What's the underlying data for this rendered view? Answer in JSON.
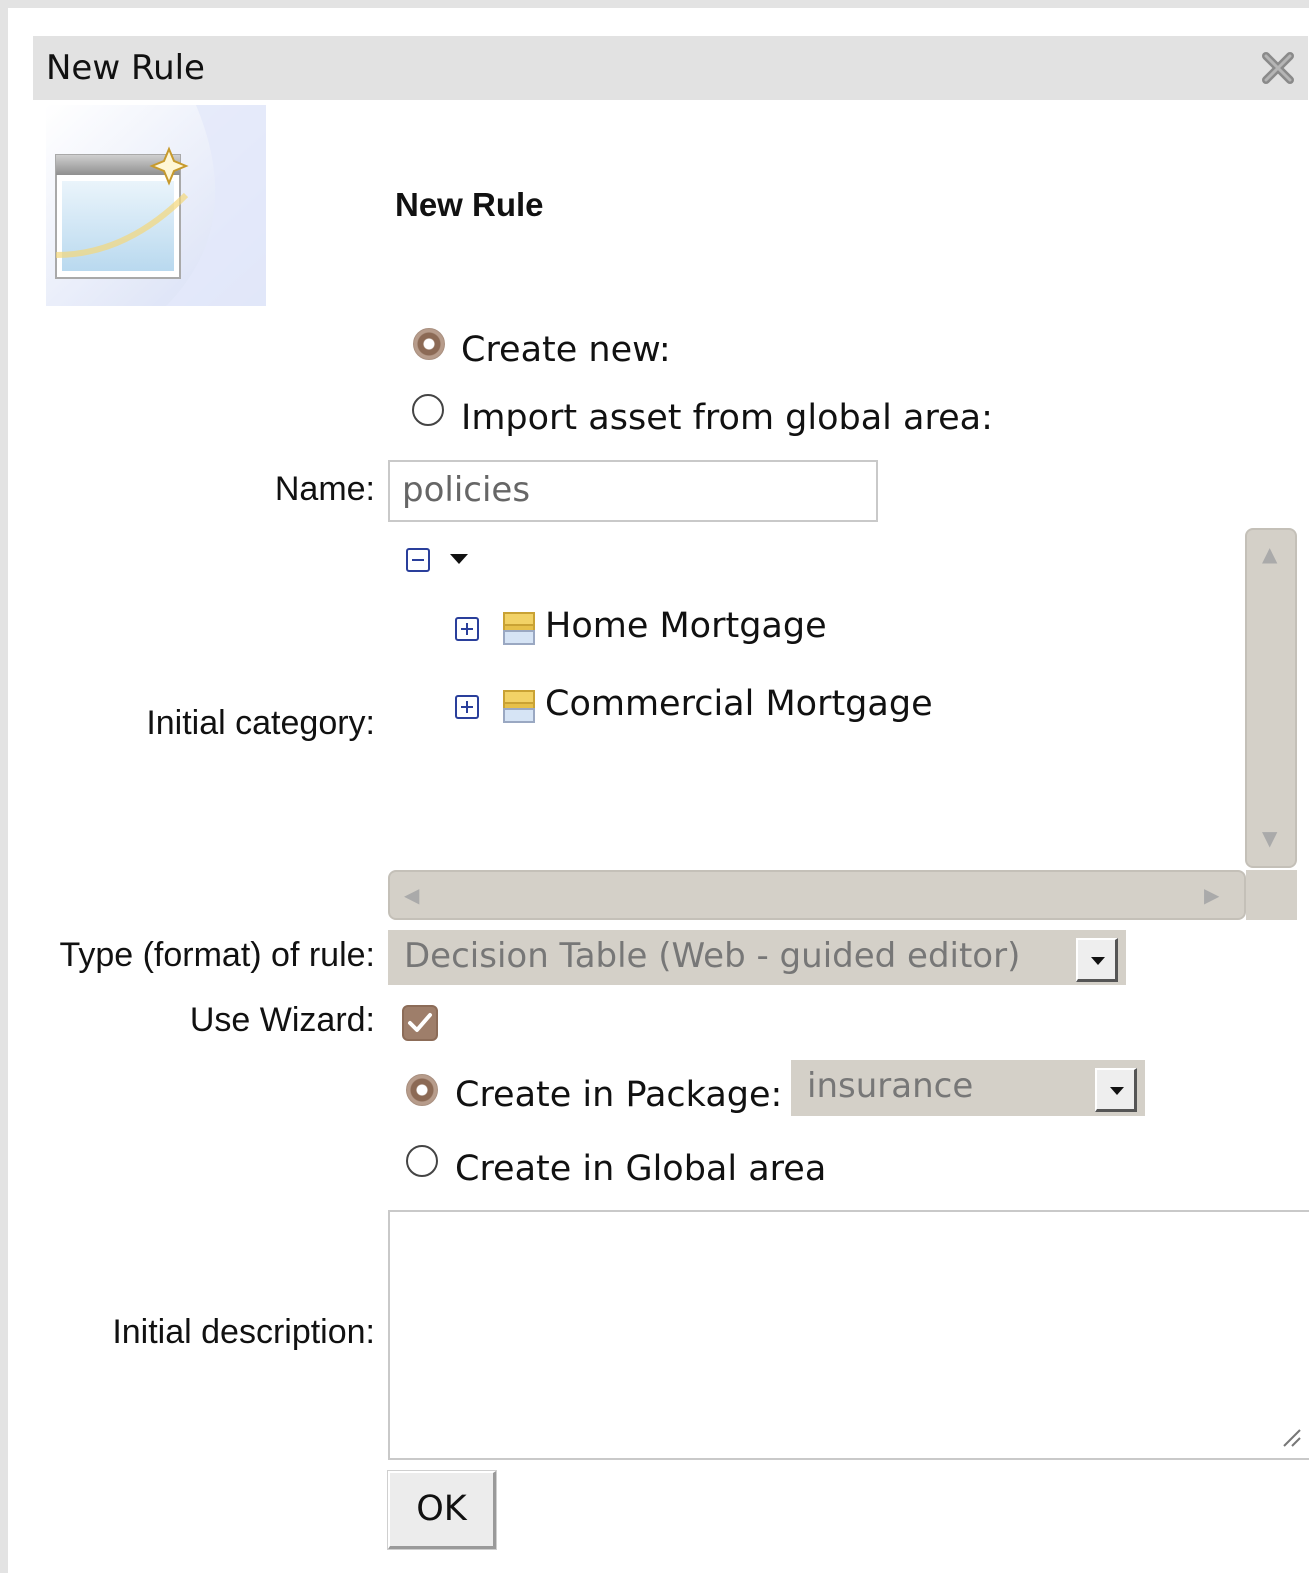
{
  "dialog": {
    "title": "New Rule",
    "heading": "New Rule"
  },
  "source": {
    "create_new_label": "Create new:",
    "import_label": "Import asset from global area:",
    "selected": "create_new"
  },
  "name": {
    "label": "Name:",
    "value": "policies"
  },
  "category": {
    "label": "Initial category:",
    "items": [
      {
        "label": "Home Mortgage"
      },
      {
        "label": "Commercial Mortgage"
      }
    ]
  },
  "rule_type": {
    "label": "Type (format) of rule:",
    "value": "Decision Table (Web - guided editor)"
  },
  "wizard": {
    "label": "Use Wizard:",
    "checked": true
  },
  "location": {
    "package_label": "Create in Package:",
    "package_value": "insurance",
    "global_label": "Create in Global area",
    "selected": "package"
  },
  "description": {
    "label": "Initial description:",
    "value": ""
  },
  "buttons": {
    "ok": "OK"
  },
  "colors": {
    "accent_radio": "#8c6a55",
    "tree_toggle": "#2a3f9b",
    "select_bg": "#d4d0c8"
  },
  "icons": [
    "close-icon",
    "new-rule-wizard-icon",
    "collapse-icon",
    "expand-icon",
    "category-folder-icon",
    "dropdown-arrow-icon",
    "checkbox-checked-icon",
    "resize-grip-icon"
  ]
}
